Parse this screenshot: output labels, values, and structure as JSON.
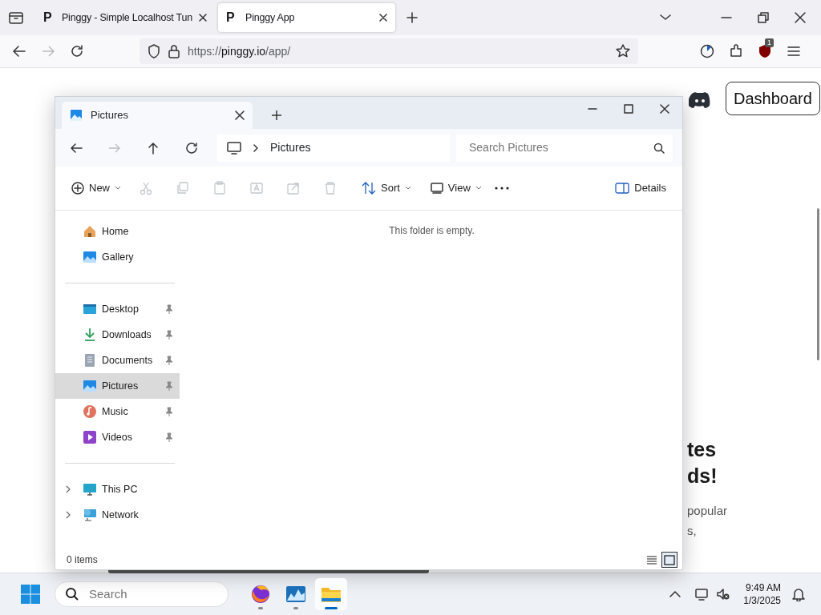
{
  "browser": {
    "tabs": [
      {
        "favicon": "P",
        "title": "Pinggy - Simple Localhost Tun",
        "selected": false
      },
      {
        "favicon": "P",
        "title": "Pinggy App",
        "selected": true
      }
    ],
    "url": {
      "scheme": "https://",
      "host": "pinggy.io",
      "path": "/app/"
    },
    "extension_badge": "1"
  },
  "website": {
    "dashboard_button": "Dashboard",
    "headline": [
      "tes",
      "ds!"
    ],
    "body": [
      "popular",
      "s,"
    ]
  },
  "explorer": {
    "tab": "Pictures",
    "address": "Pictures",
    "search": {
      "placeholder": "Search Pictures"
    },
    "toolbar": {
      "new": "New",
      "actions": [
        {
          "disabled": true
        },
        {
          "disabled": true
        },
        {
          "disabled": true
        },
        {
          "disabled": true
        },
        {
          "disabled": true
        },
        {
          "disabled": true
        }
      ],
      "sort": "Sort",
      "view": "View",
      "details": "Details"
    },
    "sidebar": [
      {
        "items": [
          {
            "label": "Home",
            "selected": false
          },
          {
            "label": "Gallery",
            "selected": false
          }
        ]
      },
      {
        "items": [
          {
            "label": "Desktop",
            "pinned": true,
            "selected": false
          },
          {
            "label": "Downloads",
            "pinned": true,
            "selected": false
          },
          {
            "label": "Documents",
            "pinned": true,
            "selected": false
          },
          {
            "label": "Pictures",
            "pinned": true,
            "selected": true
          },
          {
            "label": "Music",
            "pinned": true,
            "selected": false
          },
          {
            "label": "Videos",
            "pinned": true,
            "selected": false
          }
        ]
      },
      {
        "items": [
          {
            "label": "This PC",
            "expanded": false,
            "selected": false
          },
          {
            "label": "Network",
            "expanded": false,
            "selected": false
          }
        ]
      }
    ],
    "empty_message": "This folder is empty.",
    "status": "0 items",
    "views": [
      {
        "selected": false
      },
      {
        "selected": true
      }
    ]
  },
  "taskbar": {
    "search": {
      "placeholder": "Search"
    },
    "apps": [
      {
        "running": true,
        "active": false
      },
      {
        "running": true,
        "active": false
      },
      {
        "running": true,
        "active": true
      }
    ],
    "time": "9:49 AM",
    "date": "1/3/2025"
  }
}
